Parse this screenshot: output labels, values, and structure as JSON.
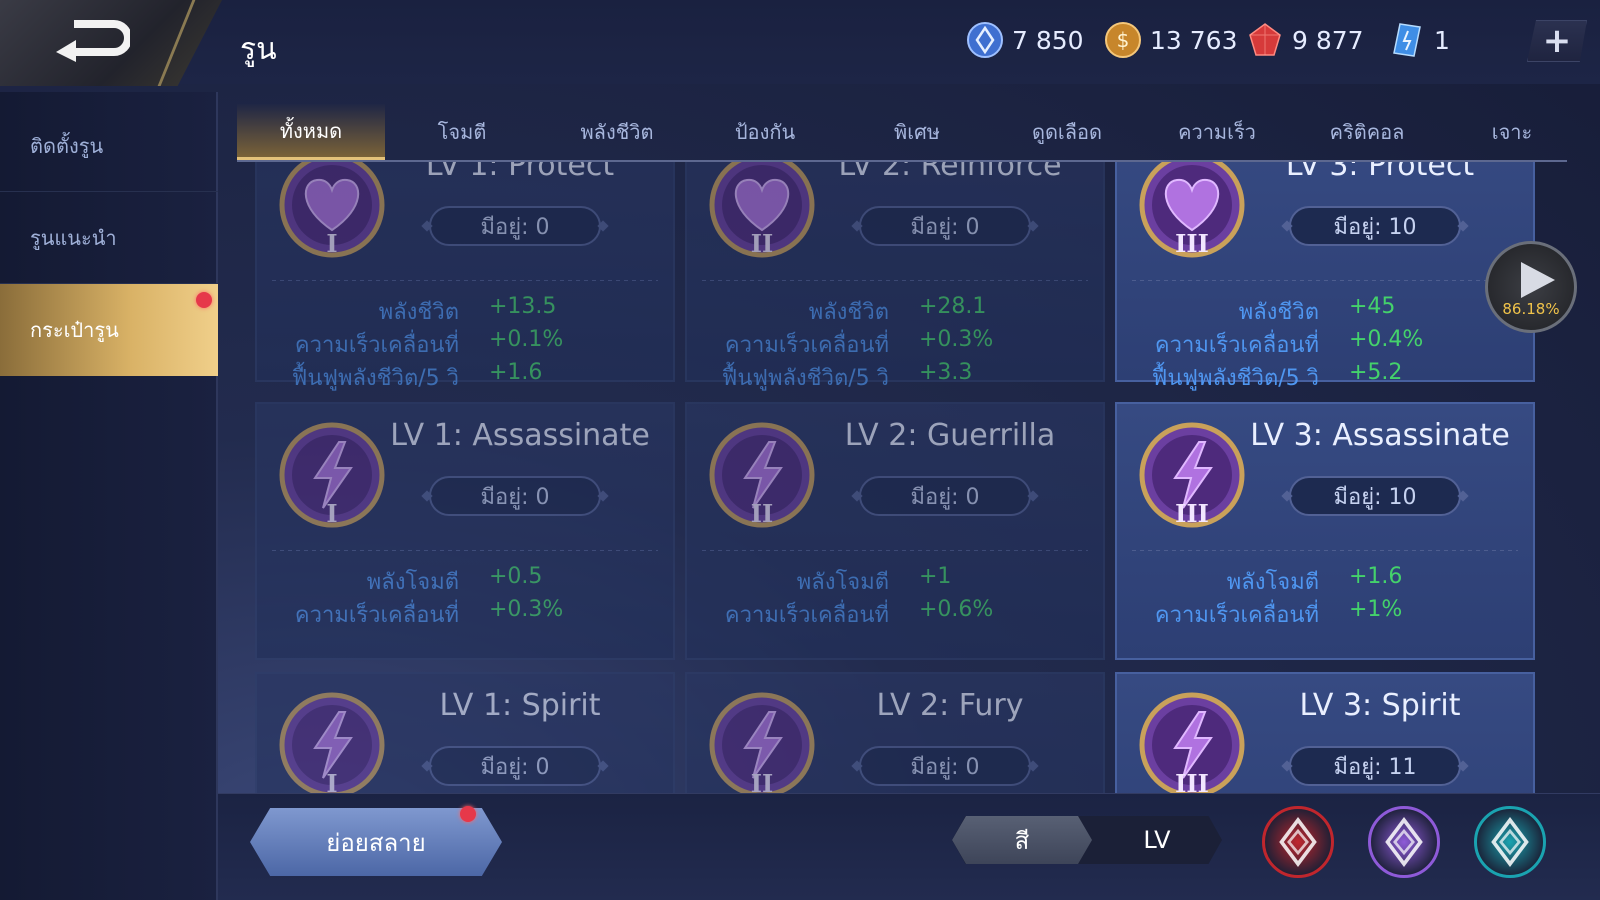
{
  "header": {
    "title": "รูน",
    "currencies": [
      {
        "icon": "voucher-icon",
        "value": "7 850"
      },
      {
        "icon": "gold-coin-icon",
        "value": "13 763"
      },
      {
        "icon": "ruby-icon",
        "value": "9 877"
      },
      {
        "icon": "crystal-icon",
        "value": "1"
      }
    ],
    "add_label": "+"
  },
  "sidebar": {
    "items": [
      {
        "label": "ติดตั้งรูน"
      },
      {
        "label": "รูนแนะนำ"
      },
      {
        "label": "กระเป๋ารูน",
        "active": true
      }
    ]
  },
  "tabs": [
    "ทั้งหมด",
    "โจมตี",
    "พลังชีวิต",
    "ป้องกัน",
    "พิเศษ",
    "ดูดเลือด",
    "ความเร็ว",
    "คริติคอล",
    "เจาะ"
  ],
  "active_tab": "ทั้งหมด",
  "runes": [
    {
      "title": "LV 1: Protect",
      "owned": "มีอยู่: 0",
      "numeral": "I",
      "type": "heart",
      "stats": [
        [
          "พลังชีวิต",
          "+13.5"
        ],
        [
          "ความเร็วเคลื่อนที่",
          "+0.1%"
        ],
        [
          "ฟื้นฟูพลังชีวิต/5 วิ",
          "+1.6"
        ]
      ]
    },
    {
      "title": "LV 2: Reinforce",
      "owned": "มีอยู่: 0",
      "numeral": "II",
      "type": "heart",
      "stats": [
        [
          "พลังชีวิต",
          "+28.1"
        ],
        [
          "ความเร็วเคลื่อนที่",
          "+0.3%"
        ],
        [
          "ฟื้นฟูพลังชีวิต/5 วิ",
          "+3.3"
        ]
      ]
    },
    {
      "title": "LV 3: Protect",
      "owned": "มีอยู่: 10",
      "numeral": "III",
      "type": "heart",
      "stats": [
        [
          "พลังชีวิต",
          "+45"
        ],
        [
          "ความเร็วเคลื่อนที่",
          "+0.4%"
        ],
        [
          "ฟื้นฟูพลังชีวิต/5 วิ",
          "+5.2"
        ]
      ]
    },
    {
      "title": "LV 1: Assassinate",
      "owned": "มีอยู่: 0",
      "numeral": "I",
      "type": "bolt",
      "stats": [
        [
          "พลังโจมตี",
          "+0.5"
        ],
        [
          "ความเร็วเคลื่อนที่",
          "+0.3%"
        ]
      ]
    },
    {
      "title": "LV 2: Guerrilla",
      "owned": "มีอยู่: 0",
      "numeral": "II",
      "type": "bolt",
      "stats": [
        [
          "พลังโจมตี",
          "+1"
        ],
        [
          "ความเร็วเคลื่อนที่",
          "+0.6%"
        ]
      ]
    },
    {
      "title": "LV 3: Assassinate",
      "owned": "มีอยู่: 10",
      "numeral": "III",
      "type": "bolt",
      "stats": [
        [
          "พลังโจมตี",
          "+1.6"
        ],
        [
          "ความเร็วเคลื่อนที่",
          "+1%"
        ]
      ]
    },
    {
      "title": "LV 1: Spirit",
      "owned": "มีอยู่: 0",
      "numeral": "I",
      "type": "bolt",
      "stats": []
    },
    {
      "title": "LV 2: Fury",
      "owned": "มีอยู่: 0",
      "numeral": "II",
      "type": "bolt",
      "stats": []
    },
    {
      "title": "LV 3: Spirit",
      "owned": "มีอยู่: 11",
      "numeral": "III",
      "type": "bolt",
      "stats": []
    }
  ],
  "play_button": {
    "percent": "86.18%"
  },
  "footer": {
    "decompose_label": "ย่อยสลาย",
    "sort_color_label": "สี",
    "sort_level_label": "LV",
    "filters": [
      {
        "icon": "red-rune-filter-icon",
        "color": "#c0262d"
      },
      {
        "icon": "purple-rune-filter-icon",
        "color": "#8e5ad8"
      },
      {
        "icon": "teal-rune-filter-icon",
        "color": "#1aa3b0"
      }
    ]
  }
}
